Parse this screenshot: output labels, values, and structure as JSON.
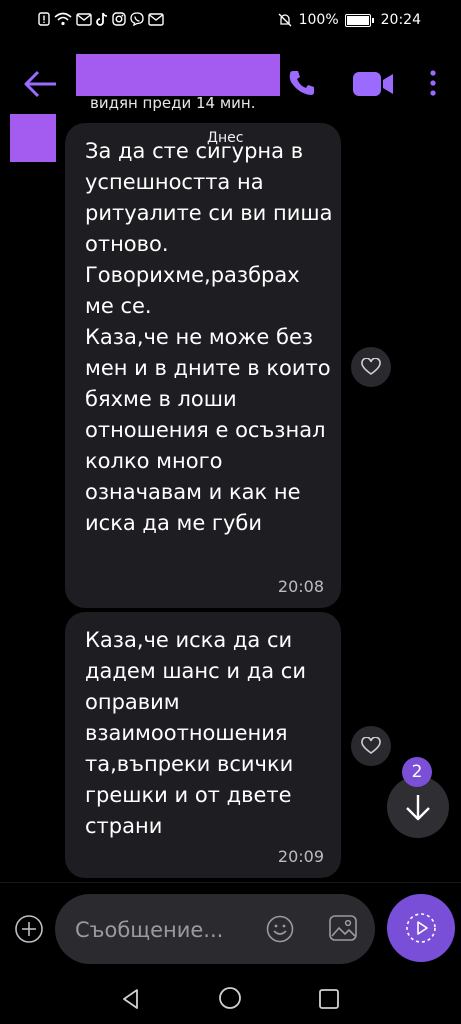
{
  "status_bar": {
    "left_icons": [
      "alert-icon",
      "wifi-icon",
      "mail-icon",
      "tiktok-icon",
      "instagram-icon",
      "viber-icon",
      "mail-icon"
    ],
    "battery_percent": "100%",
    "battery_level": 1.0,
    "time": "20:24"
  },
  "header": {
    "last_seen": "видян преди 14 мин."
  },
  "chat": {
    "date_label": "Днес",
    "messages": [
      {
        "text": "За да сте сигурна в успешността на ритуалите си ви пиша отново. Говорихме,разбрах ме се.\nКаза,че не може без мен и в дните в които бяхме в лоши отношения е осъзнал колко много означавам и как не иска да ме губи",
        "time": "20:08"
      },
      {
        "text": "Каза,че иска да си дадем шанс и да си оправим взаимоотношения та,въпреки всички грешки и от двете страни",
        "time": "20:09"
      }
    ],
    "unread_count": "2"
  },
  "composer": {
    "placeholder": "Съобщение..."
  },
  "colors": {
    "accent": "#7a4fd8",
    "redaction": "#a45cf0",
    "bubble": "#1d1d22"
  }
}
